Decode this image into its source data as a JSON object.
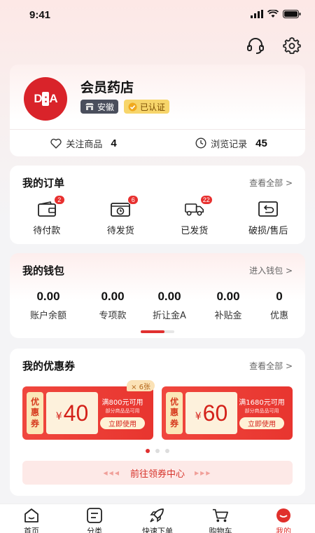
{
  "status": {
    "time": "9:41"
  },
  "profile": {
    "logo_text": "D:A",
    "store_name": "会员药店",
    "location_badge": "安徽",
    "cert_badge": "已认证",
    "favorites_label": "关注商品",
    "favorites_count": "4",
    "history_label": "浏览记录",
    "history_count": "45"
  },
  "orders": {
    "title": "我的订单",
    "view_all": "查看全部 >",
    "items": [
      {
        "label": "待付款",
        "badge": "2",
        "icon": "wallet-icon"
      },
      {
        "label": "待发货",
        "badge": "6",
        "icon": "package-clock-icon"
      },
      {
        "label": "已发货",
        "badge": "22",
        "icon": "truck-icon"
      },
      {
        "label": "破损/售后",
        "badge": "",
        "icon": "return-icon"
      }
    ]
  },
  "wallet": {
    "title": "我的钱包",
    "link": "进入钱包 >",
    "items": [
      {
        "amount": "0.00",
        "label": "账户余额"
      },
      {
        "amount": "0.00",
        "label": "专项款"
      },
      {
        "amount": "0.00",
        "label": "折让金A"
      },
      {
        "amount": "0.00",
        "label": "补贴金"
      },
      {
        "amount": "0",
        "label": "优惠"
      }
    ]
  },
  "coupons": {
    "title": "我的优惠券",
    "view_all": "查看全部 >",
    "items": [
      {
        "tag": "优惠券",
        "currency": "¥",
        "value": "40",
        "condition": "满800元可用",
        "scope": "部分商品品可用",
        "button": "立即使用",
        "count": "× 6张"
      },
      {
        "tag": "优惠券",
        "currency": "¥",
        "value": "60",
        "condition": "满1680元可用",
        "scope": "部分商品品可用",
        "button": "立即使用",
        "count": ""
      }
    ],
    "center_link": "前往领券中心"
  },
  "tabbar": [
    {
      "label": "首页",
      "icon": "home-icon",
      "active": false
    },
    {
      "label": "分类",
      "icon": "category-icon",
      "active": false
    },
    {
      "label": "快速下单",
      "icon": "rocket-icon",
      "active": false
    },
    {
      "label": "购物车",
      "icon": "cart-icon",
      "active": false
    },
    {
      "label": "我的",
      "icon": "profile-icon",
      "active": true
    }
  ],
  "colors": {
    "accent": "#e0302c",
    "coupon_red": "#ee4038",
    "gold": "#f7d56b"
  }
}
